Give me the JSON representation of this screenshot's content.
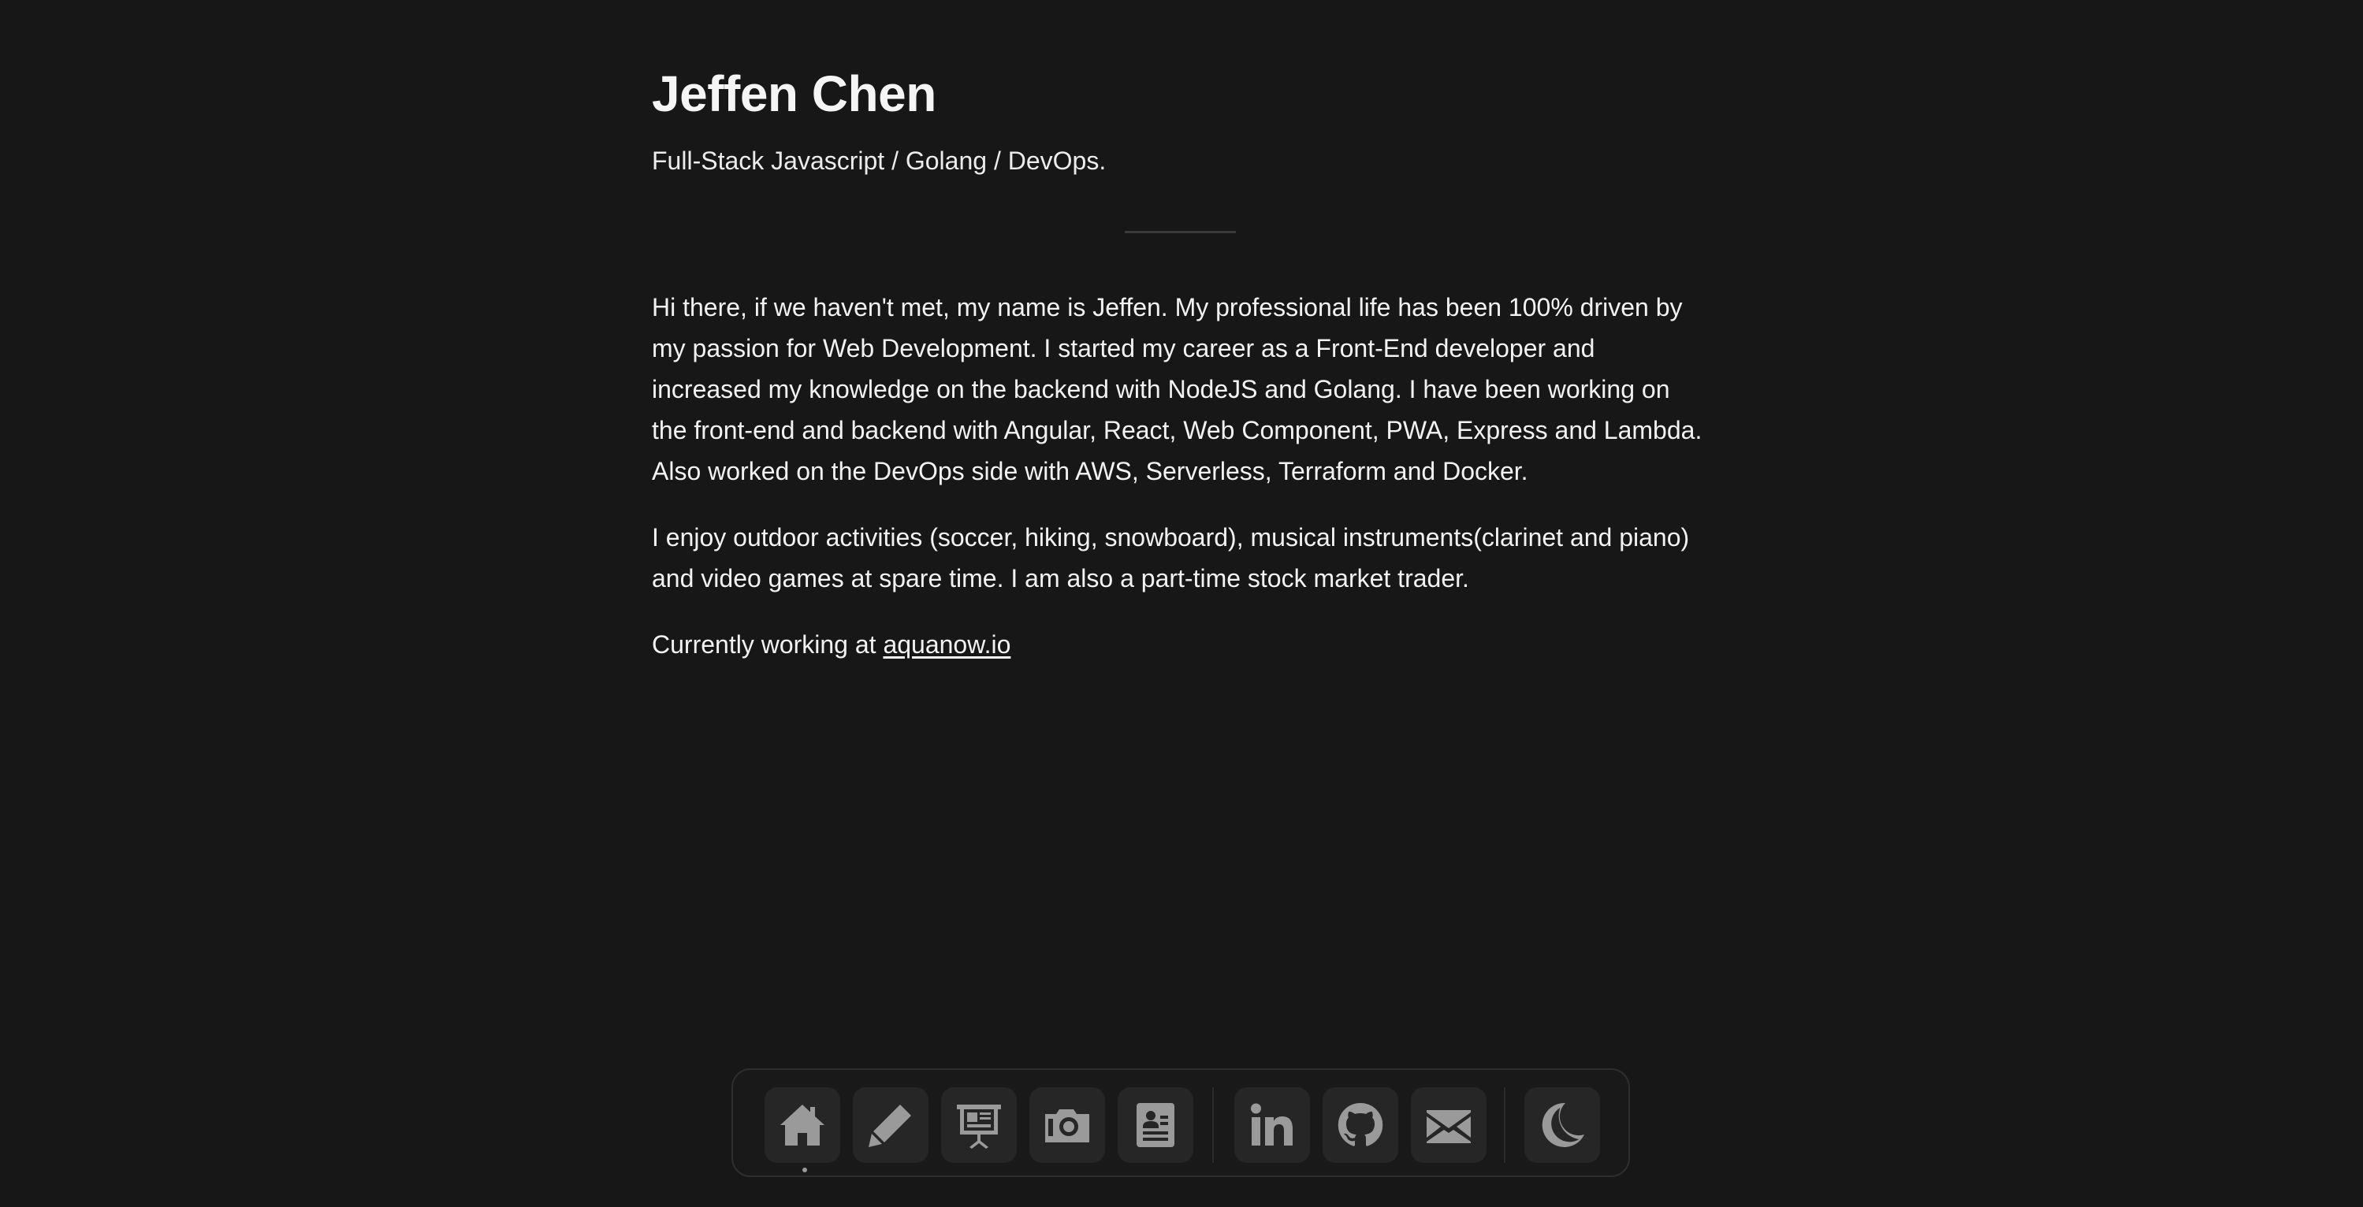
{
  "header": {
    "name": "Jeffen Chen",
    "tagline": "Full-Stack Javascript / Golang / DevOps."
  },
  "about": {
    "paragraph_1": "Hi there, if we haven't met, my name is Jeffen. My professional life has been 100% driven by my passion for Web Development. I started my career as a Front-End developer and increased my knowledge on the backend with NodeJS and Golang. I have been working on the front-end and backend with Angular, React, Web Component, PWA, Express and Lambda. Also worked on the DevOps side with AWS, Serverless, Terraform and Docker.",
    "paragraph_2": "I enjoy outdoor activities (soccer, hiking, snowboard), musical instruments(clarinet and piano) and video games at spare time. I am also a part-time stock market trader.",
    "currently_prefix": "Currently working at ",
    "company_link": "aquanow.io"
  },
  "dock": {
    "items": [
      {
        "icon": "home-icon",
        "active": true
      },
      {
        "icon": "pencil-icon"
      },
      {
        "icon": "presentation-icon"
      },
      {
        "icon": "camera-icon"
      },
      {
        "icon": "contact-card-icon"
      },
      {
        "icon": "linkedin-icon"
      },
      {
        "icon": "github-icon"
      },
      {
        "icon": "mail-icon"
      },
      {
        "icon": "moon-icon"
      }
    ]
  },
  "colors": {
    "background": "#171717",
    "text": "#f2f2f2",
    "icon": "#9a9a9a",
    "dock_button": "#262626"
  }
}
